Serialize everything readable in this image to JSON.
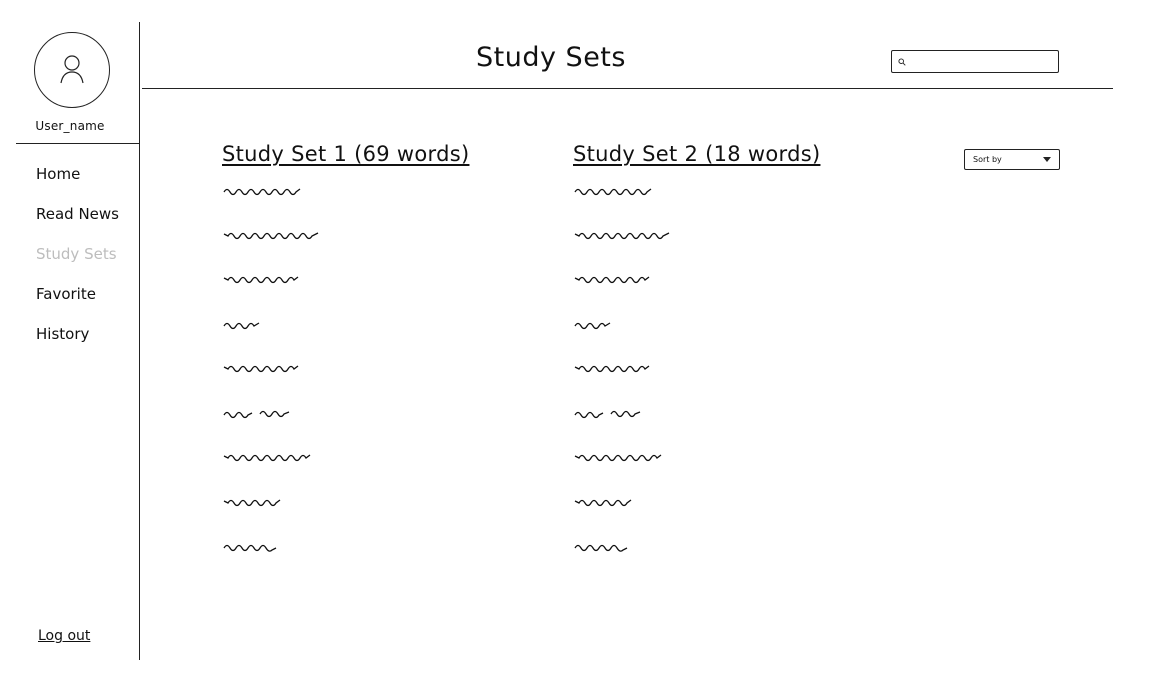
{
  "sidebar": {
    "username": "User_name",
    "nav": [
      {
        "label": "Home",
        "active": false
      },
      {
        "label": "Read News",
        "active": false
      },
      {
        "label": "Study Sets",
        "active": true
      },
      {
        "label": "Favorite",
        "active": false
      },
      {
        "label": "History",
        "active": false
      }
    ],
    "logout_label": "Log out"
  },
  "header": {
    "title": "Study Sets",
    "search": {
      "value": "",
      "placeholder": ""
    }
  },
  "sort": {
    "label": "Sort by"
  },
  "study_sets": [
    {
      "title": "Study Set 1 (69 words)"
    },
    {
      "title": "Study Set 2 (18 words)"
    }
  ],
  "colors": {
    "line": "#222222",
    "active_nav": "#bdbdbd",
    "background": "#ffffff"
  }
}
